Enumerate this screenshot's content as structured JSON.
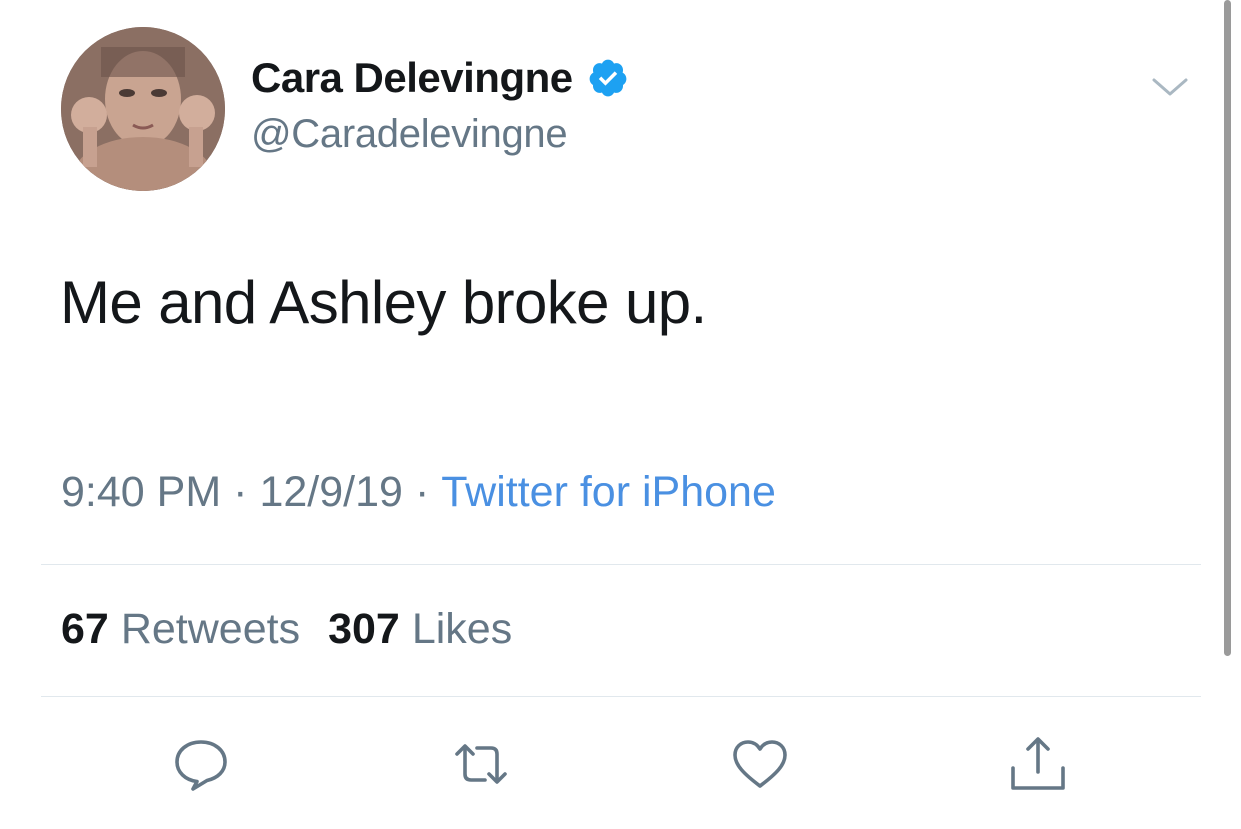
{
  "tweet": {
    "author": {
      "display_name": "Cara Delevingne",
      "handle": "@Caradelevingne",
      "verified": true
    },
    "text": "Me and Ashley broke up.",
    "time": "9:40 PM",
    "date": "12/9/19",
    "separator": "·",
    "source": "Twitter for iPhone",
    "stats": {
      "retweets_count": "67",
      "retweets_label": "Retweets",
      "likes_count": "307",
      "likes_label": "Likes"
    }
  },
  "icons": {
    "verified": "verified-badge-icon",
    "menu": "chevron-down-icon",
    "reply": "reply-icon",
    "retweet": "retweet-icon",
    "like": "heart-icon",
    "share": "share-icon"
  },
  "colors": {
    "text_primary": "#14171a",
    "text_secondary": "#657786",
    "link": "#4a90e2",
    "verified": "#1da1f2",
    "divider": "#e1e8ed"
  }
}
